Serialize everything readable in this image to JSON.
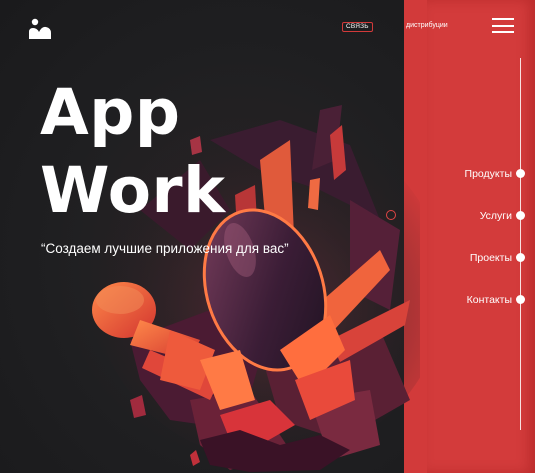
{
  "header": {
    "logo_icon": "image-icon",
    "contact_label": "СВЯЗЬ",
    "distribution_label": "дистрибуции",
    "menu_icon": "hamburger-menu-icon"
  },
  "hero": {
    "title_line1": "App",
    "title_line2": "Work",
    "subtitle": "“Создаем лучшие приложения для вас”"
  },
  "nav": {
    "items": [
      {
        "label": "Продукты"
      },
      {
        "label": "Услуги"
      },
      {
        "label": "Проекты"
      },
      {
        "label": "Контакты"
      }
    ]
  },
  "colors": {
    "accent": "#d23a3a",
    "background": "#1f1f21",
    "text": "#ffffff"
  }
}
